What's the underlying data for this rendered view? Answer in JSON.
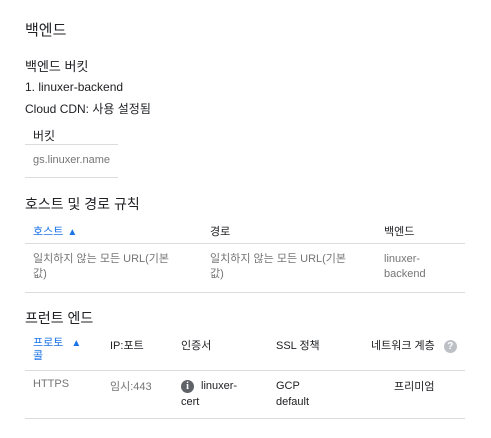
{
  "page_title": "백엔드",
  "bucket_section": {
    "heading": "백엔드 버킷",
    "item_name": "1. linuxer-backend",
    "cdn_status": "Cloud CDN: 사용 설정됨",
    "table_header": "버킷",
    "table_value": "gs.linuxer.name"
  },
  "host_rules": {
    "heading": "호스트 및 경로 규칙",
    "columns": {
      "host": "호스트",
      "path": "경로",
      "backend": "백엔드"
    },
    "rows": [
      {
        "host_line1": "일치하지 않는 모든 URL(기본",
        "host_line2": "값)",
        "path_line1": "일치하지 않는 모든 URL(기본",
        "path_line2": "값)",
        "backend_line1": "linuxer-",
        "backend_line2": "backend"
      }
    ]
  },
  "frontend": {
    "heading": "프런트 엔드",
    "columns": {
      "protocol_line1": "프로토",
      "protocol_line2": "콜",
      "ip_port": "IP:포트",
      "certificate": "인증서",
      "ssl_policy": "SSL 정책",
      "network_tier": "네트워크 계층"
    },
    "rows": [
      {
        "protocol": "HTTPS",
        "ip_port": "임시:443",
        "cert_line1": "linuxer-",
        "cert_line2": "cert",
        "ssl_line1": "GCP",
        "ssl_line2": "default",
        "network_tier": "프리미엄"
      }
    ]
  },
  "icons": {
    "sort": "arrow-up-icon",
    "info": "info-icon",
    "help": "help-icon"
  },
  "colors": {
    "link_blue": "#1a73e8",
    "divider": "#dadce0",
    "text": "#202124",
    "muted": "#5f6368"
  }
}
